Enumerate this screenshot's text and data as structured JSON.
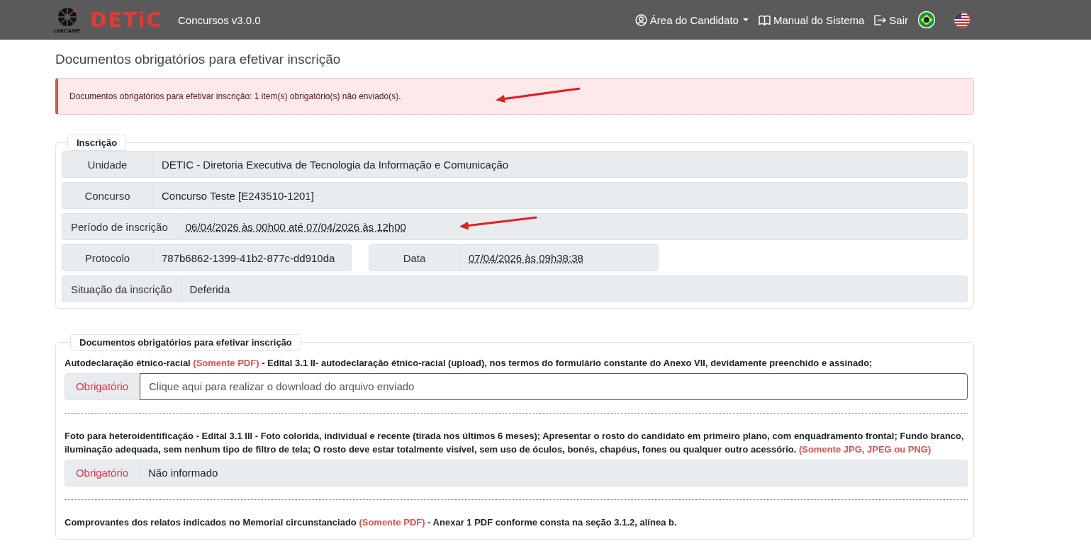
{
  "navbar": {
    "logo_caption": "UNICAMP",
    "logo_text": "DETiC",
    "app_name": "Concursos v3.0.0",
    "links": [
      {
        "kind": "user",
        "label": "Área do Candidato",
        "dropdown": true
      },
      {
        "kind": "book",
        "label": "Manual do Sistema",
        "dropdown": false
      },
      {
        "kind": "exit",
        "label": "Sair",
        "dropdown": false
      }
    ],
    "languages": [
      {
        "kind": "br",
        "selected": true
      },
      {
        "kind": "us",
        "selected": false
      }
    ]
  },
  "page_title": "Documentos obrigatórios para efetivar inscrição",
  "alert": "Documentos obrigatórios para efetivar inscrição: 1 item(s) obrigatório(s) não enviado(s).",
  "registration": {
    "legend": "Inscrição",
    "rows": [
      [
        {
          "label": "Unidade",
          "value": "DETIC - Diretoria Executiva de Tecnologia da Informação e Comunicação",
          "dotted": false
        }
      ],
      [
        {
          "label": "Concurso",
          "value": "Concurso Teste [E243510-1201]",
          "dotted": false
        }
      ],
      [
        {
          "label": "Período de inscrição",
          "value": "06/04/2026 às 00h00 até 07/04/2026 às 12h00",
          "dotted": true
        }
      ],
      [
        {
          "label": "Protocolo",
          "value": "787b6862-1399-41b2-877c-dd910da",
          "dotted": false
        },
        {
          "label": "Data",
          "value": "07/04/2026 às 09h38:38",
          "dotted": true
        }
      ],
      [
        {
          "label": "Situação da inscrição",
          "value": "Deferida",
          "dotted": false
        }
      ]
    ]
  },
  "documents": {
    "legend": "Documentos obrigatórios para efetivar inscrição",
    "items": [
      {
        "description": [
          {
            "text": "Autodeclaração étnico-racial ",
            "highlight": false
          },
          {
            "text": "(Somente PDF)",
            "highlight": true
          },
          {
            "text": " - Edital 3.1 II- autodeclaração étnico-racial (upload), nos termos do formulário constante do Anexo VII, devidamente preenchido e assinado;",
            "highlight": false
          }
        ],
        "status": "Obrigatório",
        "value": "Clique aqui para realizar o download do arquivo enviado",
        "kind": "link"
      },
      {
        "description": [
          {
            "text": "Foto para heteroidentificação - Edital 3.1 III - Foto colorida, individual e recente (tirada nos últimos 6 meses); Apresentar o rosto do candidato em primeiro plano, com enquadramento frontal; Fundo branco, iluminação adequada, sem nenhum tipo de filtro de tela; O rosto deve estar totalmente visível, sem uso de óculos, bonés, chapéus, fones ou qualquer outro acessório. ",
            "highlight": false
          },
          {
            "text": "(Somente JPG, JPEG ou PNG)",
            "highlight": true
          }
        ],
        "status": "Obrigatório",
        "value": "Não informado",
        "kind": "empty"
      },
      {
        "description": [
          {
            "text": "Comprovantes dos relatos indicados no Memorial circunstanciado ",
            "highlight": false
          },
          {
            "text": "(Somente PDF)",
            "highlight": true
          },
          {
            "text": " - Anexar 1 PDF conforme consta na seção 3.1.2, alínea b.",
            "highlight": false
          }
        ],
        "kind": "cut"
      }
    ]
  }
}
